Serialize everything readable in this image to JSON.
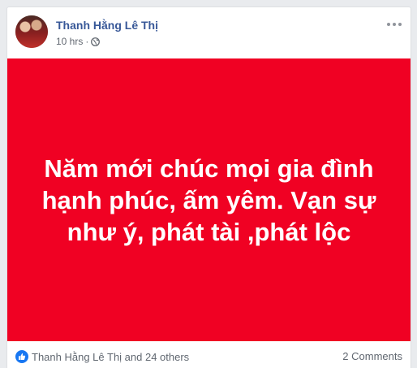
{
  "post": {
    "author": "Thanh Hằng Lê Thị",
    "time": "10 hrs",
    "separator": "·",
    "privacy_icon": "globe-icon",
    "more_icon": "more-options-icon",
    "background_color": "#f00123",
    "text": "Năm mới chúc mọi gia đình hạnh phúc, ấm yêm. Vạn sự như ý, phát tài ,phát lộc"
  },
  "footer": {
    "reactions_icon": "like-icon",
    "reactions_color": "#1877f2",
    "reactions_text": "Thanh Hằng Lê Thị and 24 others",
    "comments_text": "2 Comments"
  },
  "colors": {
    "author_link": "#385898",
    "meta_text": "#616770"
  }
}
